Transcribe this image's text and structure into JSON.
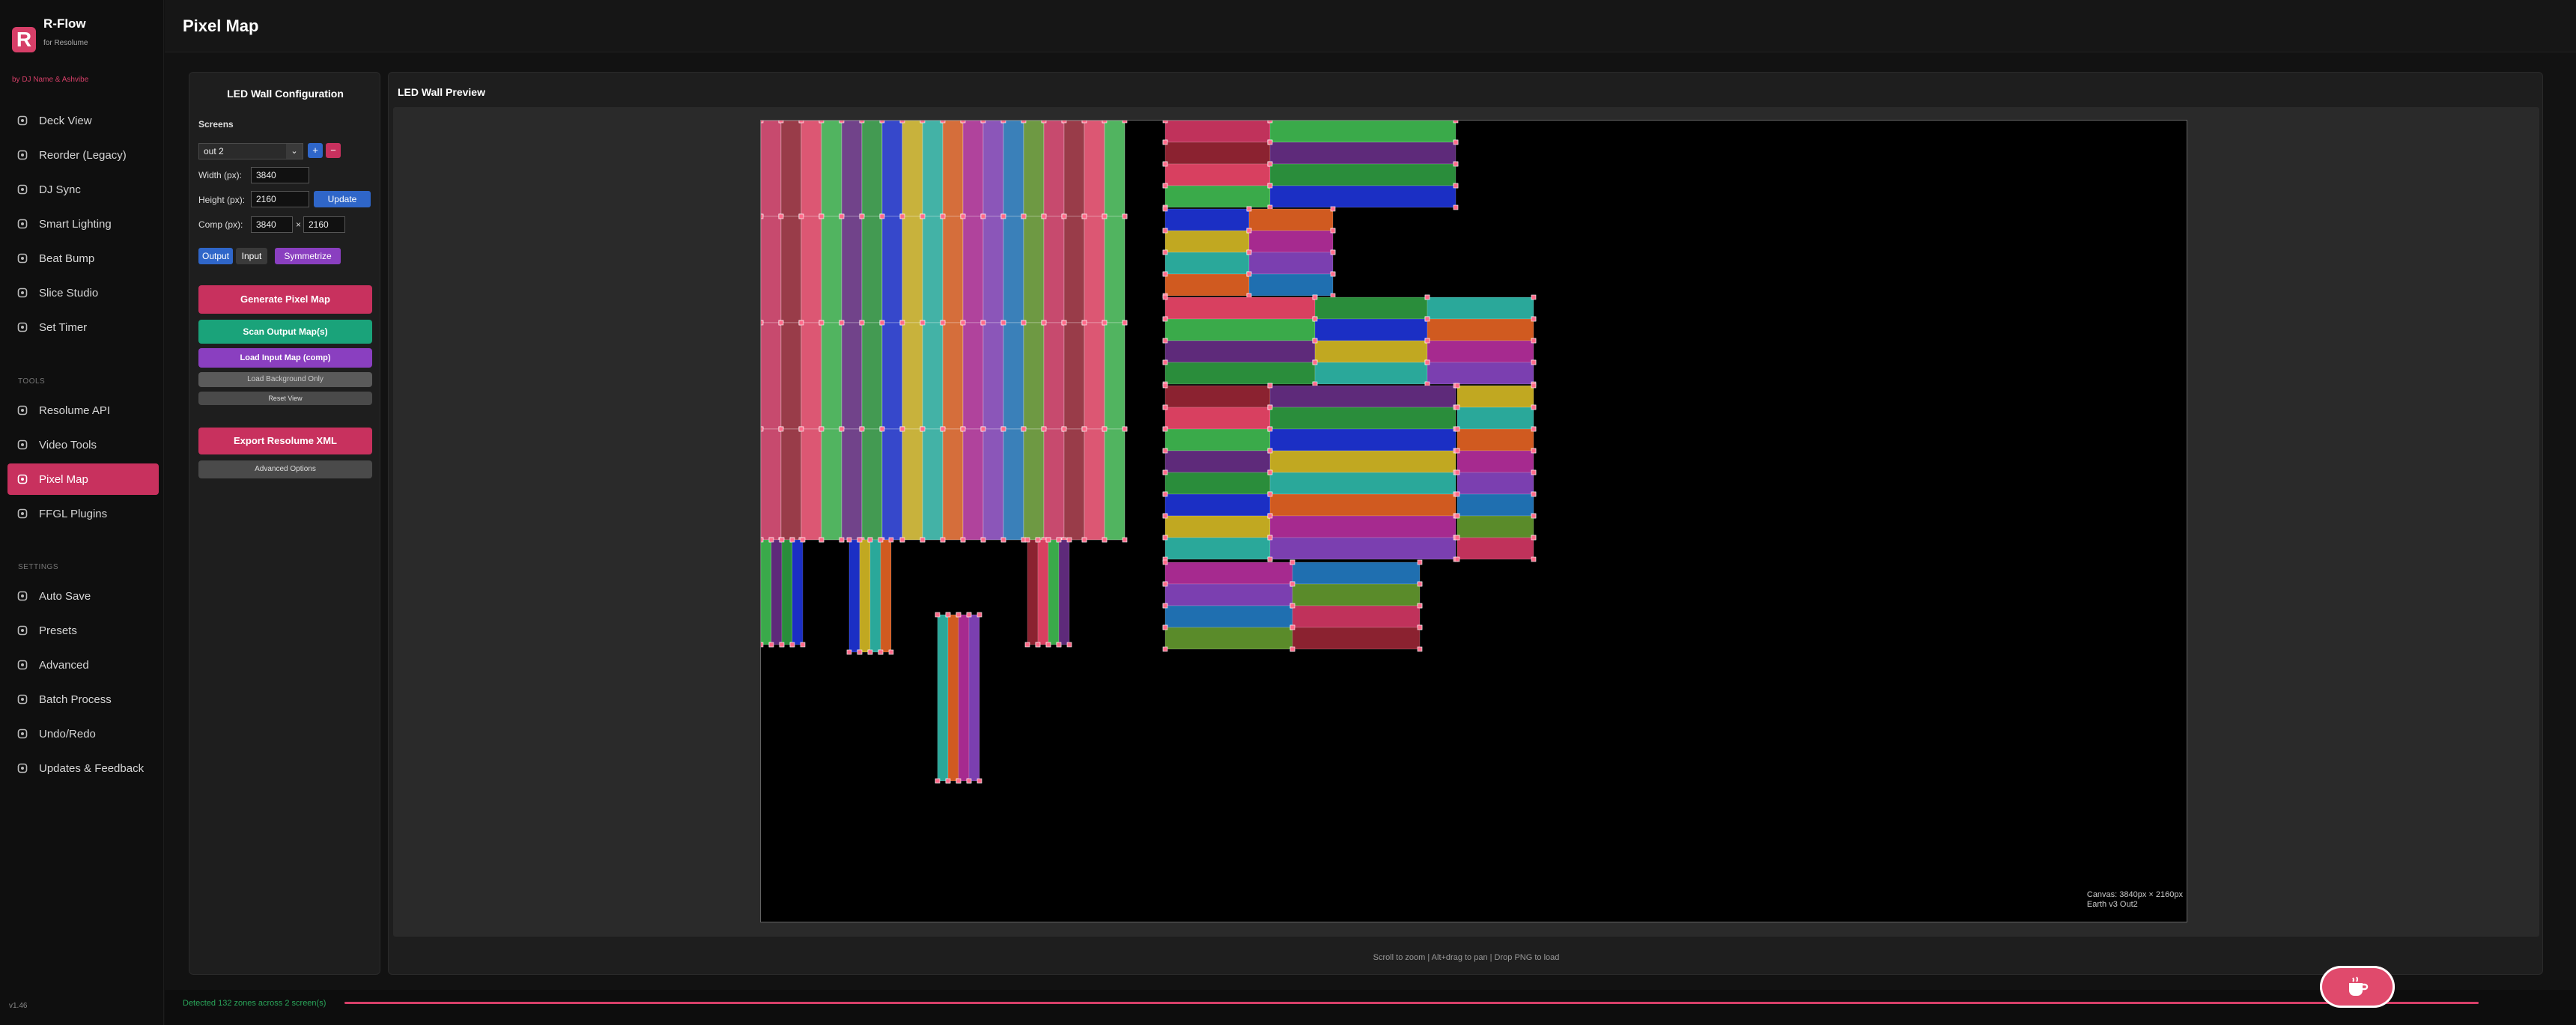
{
  "app": {
    "name": "R-Flow",
    "subtitle": "for Resolume",
    "byline": "by DJ Name & Ashvibe",
    "version": "v1.46",
    "page_title": "Pixel Map"
  },
  "sidebar": {
    "main_items": [
      {
        "label": "Deck View",
        "icon": "grid-icon"
      },
      {
        "label": "Reorder (Legacy)",
        "icon": "reorder-icon"
      },
      {
        "label": "DJ Sync",
        "icon": "sync-icon"
      },
      {
        "label": "Smart Lighting",
        "icon": "lightbulb-icon"
      },
      {
        "label": "Beat Bump",
        "icon": "beat-icon"
      },
      {
        "label": "Slice Studio",
        "icon": "slice-icon"
      },
      {
        "label": "Set Timer",
        "icon": "timer-icon"
      }
    ],
    "tools_label": "TOOLS",
    "tools_items": [
      {
        "label": "Resolume API",
        "icon": "plug-icon"
      },
      {
        "label": "Video Tools",
        "icon": "film-icon"
      },
      {
        "label": "Pixel Map",
        "icon": "pixel-map-icon",
        "active": true
      },
      {
        "label": "FFGL Plugins",
        "icon": "puzzle-icon"
      }
    ],
    "settings_label": "SETTINGS",
    "settings_items": [
      {
        "label": "Auto Save",
        "icon": "save-icon"
      },
      {
        "label": "Presets",
        "icon": "presets-icon"
      },
      {
        "label": "Advanced",
        "icon": "gear-icon"
      },
      {
        "label": "Batch Process",
        "icon": "batch-icon"
      },
      {
        "label": "Undo/Redo",
        "icon": "undo-icon"
      },
      {
        "label": "Updates & Feedback",
        "icon": "feedback-icon"
      }
    ]
  },
  "config": {
    "title": "LED Wall Configuration",
    "screens_label": "Screens",
    "screen_selected": "out 2",
    "add_screen": "+",
    "remove_screen": "−",
    "width_label": "Width (px):",
    "width_value": "3840",
    "height_label": "Height (px):",
    "height_value": "2160",
    "update_label": "Update",
    "comp_label": "Comp (px):",
    "comp_width": "3840",
    "comp_sep": "×",
    "comp_height": "2160",
    "mode_output": "Output",
    "mode_input": "Input",
    "symmetrize": "Symmetrize",
    "generate": "Generate Pixel Map",
    "scan": "Scan Output Map(s)",
    "load_input": "Load Input Map (comp)",
    "load_bg": "Load Background Only",
    "reset_view": "Reset View",
    "export": "Export Resolume XML",
    "advanced": "Advanced Options"
  },
  "preview": {
    "title": "LED Wall Preview",
    "canvas_caption_1": "Canvas: 3840px × 2160px",
    "canvas_caption_2": "Earth v3 Out2",
    "hint": "Scroll to zoom | Alt+drag to pan | Drop PNG to load",
    "panel_palette": [
      "#c0325b",
      "#8b2230",
      "#d84060",
      "#3aaa4a",
      "#5e2a7a",
      "#2a8d3b",
      "#1b2fc4",
      "#c1a821",
      "#2aa89a",
      "#d05a20",
      "#a62a8f",
      "#7b3fb0",
      "#1f6fb0",
      "#5a8b2a"
    ]
  },
  "status": {
    "text": "Detected 132 zones across 2 screen(s)",
    "progress": 1.0
  },
  "colors": {
    "accent": "#d63f68",
    "success": "#1aa37a",
    "blue": "#2f66c9",
    "purple": "#8a3fc0"
  }
}
